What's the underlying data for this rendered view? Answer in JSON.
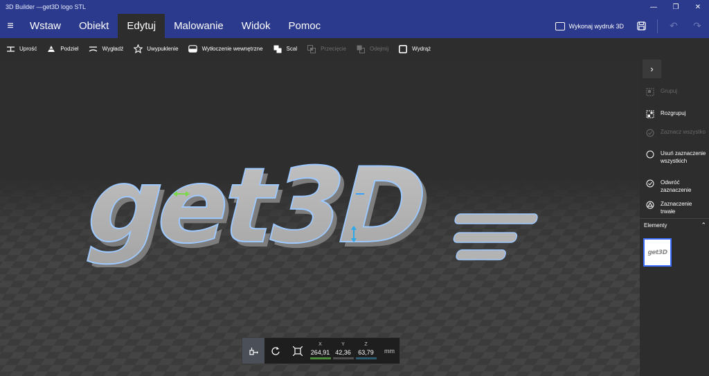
{
  "window": {
    "title": "3D Builder —get3D logo STL",
    "controls": [
      "minimize",
      "restore",
      "close"
    ]
  },
  "menu": {
    "tabs": [
      {
        "label": "Wstaw",
        "active": false
      },
      {
        "label": "Obiekt",
        "active": false
      },
      {
        "label": "Edytuj",
        "active": true
      },
      {
        "label": "Malowanie",
        "active": false
      },
      {
        "label": "Widok",
        "active": false
      },
      {
        "label": "Pomoc",
        "active": false
      }
    ],
    "print_label": "Wykonaj wydruk 3D"
  },
  "toolbar": {
    "items": [
      {
        "label": "Uprość",
        "icon": "simplify-icon",
        "enabled": true
      },
      {
        "label": "Podziel",
        "icon": "split-icon",
        "enabled": true
      },
      {
        "label": "Wygładź",
        "icon": "smooth-icon",
        "enabled": true
      },
      {
        "label": "Uwypuklenie",
        "icon": "star-icon",
        "enabled": true
      },
      {
        "label": "Wytłoczenie wewnętrzne",
        "icon": "emboss-icon",
        "enabled": true
      },
      {
        "label": "Scal",
        "icon": "merge-icon",
        "enabled": true
      },
      {
        "label": "Przecięcie",
        "icon": "intersect-icon",
        "enabled": false
      },
      {
        "label": "Odejmij",
        "icon": "subtract-icon",
        "enabled": false
      },
      {
        "label": "Wydrąż",
        "icon": "hollow-icon",
        "enabled": true
      }
    ]
  },
  "coords": {
    "x_label": "X",
    "x_value": "264,91",
    "x_color": "#4a8a3a",
    "y_label": "Y",
    "y_value": "42,36",
    "y_color": "#505050",
    "z_label": "Z",
    "z_value": "63,79",
    "z_color": "#2e5a72",
    "unit": "mm"
  },
  "right_panel": {
    "actions": [
      {
        "label": "Grupuj",
        "enabled": false,
        "icon": "group-icon"
      },
      {
        "label": "Rozgrupuj",
        "enabled": true,
        "icon": "ungroup-icon"
      },
      {
        "label": "Zaznacz wszystko",
        "enabled": false,
        "icon": "select-all-icon"
      },
      {
        "label": "Usuń zaznaczenie wszystkich",
        "enabled": true,
        "icon": "deselect-icon"
      },
      {
        "label": "Odwróć zaznaczenie",
        "enabled": true,
        "icon": "invert-selection-icon"
      },
      {
        "label": "Zaznaczenie trwałe",
        "enabled": true,
        "icon": "persistent-selection-icon"
      }
    ],
    "elements_label": "Elementy",
    "thumbnail_text": "get3D"
  },
  "scene": {
    "model_text": "get3D"
  },
  "colors": {
    "titlebar": "#2b3a8c",
    "toolbar": "#2d2d2d",
    "selection_outline": "#9ec9ff",
    "thumb_border": "#3c6eff"
  }
}
